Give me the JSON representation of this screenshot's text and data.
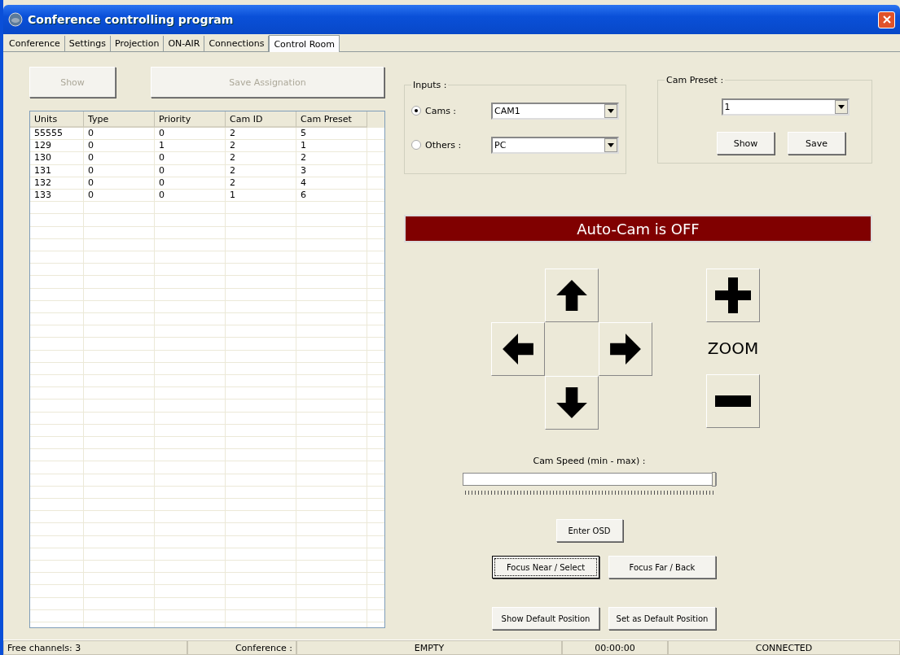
{
  "window": {
    "title": "Conference controlling program"
  },
  "tabs": [
    {
      "label": "Conference",
      "selected": false
    },
    {
      "label": "Settings",
      "selected": false
    },
    {
      "label": "Projection",
      "selected": false
    },
    {
      "label": "ON-AIR",
      "selected": false
    },
    {
      "label": "Connections",
      "selected": false
    },
    {
      "label": "Control Room",
      "selected": true
    }
  ],
  "left_buttons": [
    {
      "label": "Show",
      "disabled": true
    },
    {
      "label": "Save Assignation",
      "disabled": true
    }
  ],
  "table": {
    "columns": [
      "Units",
      "Type",
      "Priority",
      "Cam ID",
      "Cam Preset"
    ],
    "rows": [
      [
        "55555",
        "0",
        "0",
        "2",
        "5"
      ],
      [
        "129",
        "0",
        "1",
        "2",
        "1"
      ],
      [
        "130",
        "0",
        "0",
        "2",
        "2"
      ],
      [
        "131",
        "0",
        "0",
        "2",
        "3"
      ],
      [
        "132",
        "0",
        "0",
        "2",
        "4"
      ],
      [
        "133",
        "0",
        "0",
        "1",
        "6"
      ]
    ]
  },
  "inputs": {
    "title": "Inputs :",
    "options": [
      {
        "label": "Cams :",
        "selected": true,
        "value": "CAM1"
      },
      {
        "label": "Others :",
        "selected": false,
        "value": "PC"
      }
    ]
  },
  "cam_preset": {
    "title": "Cam Preset :",
    "value": "1",
    "buttons": [
      "Show",
      "Save"
    ]
  },
  "auto_cam": {
    "text": "Auto-Cam is OFF",
    "on": false
  },
  "zoom": {
    "label": "ZOOM"
  },
  "cam_speed": {
    "label": "Cam Speed (min - max) :",
    "level": 1.0
  },
  "buttons": [
    {
      "label": "Enter OSD",
      "focused": false
    },
    {
      "label": "Focus Near / Select",
      "focused": true
    },
    {
      "label": "Focus Far / Back",
      "focused": false
    },
    {
      "label": "Show Default Position",
      "focused": false
    },
    {
      "label": "Set as Default Position",
      "focused": false
    }
  ],
  "status_bar": {
    "free_channels": "Free channels: 3",
    "conference_label": "Conference :",
    "conference_value": "EMPTY",
    "time": "00:00:00",
    "connection": "CONNECTED"
  }
}
